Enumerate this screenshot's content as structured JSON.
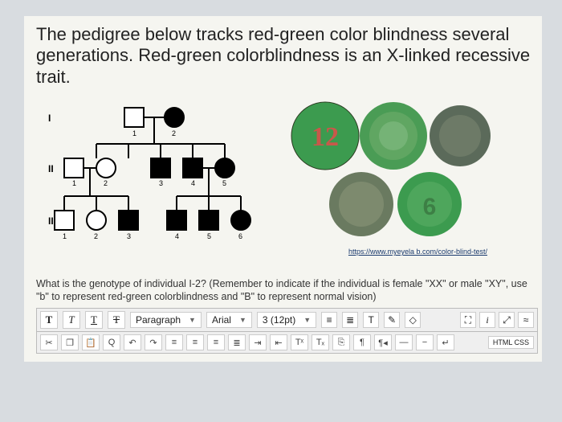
{
  "intro": "The pedigree below tracks red-green color blindness several generations. Red-green colorblindness is an X-linked recessive trait.",
  "pedigree": {
    "generations": [
      "I",
      "II",
      "III"
    ],
    "rows": [
      {
        "label": "I",
        "labels": [
          "1",
          "2"
        ]
      },
      {
        "label": "II",
        "labels": [
          "1",
          "2",
          "3",
          "4",
          "5"
        ]
      },
      {
        "label": "III",
        "labels": [
          "1",
          "2",
          "3",
          "4",
          "5",
          "6"
        ]
      }
    ]
  },
  "plates": {
    "values": [
      "12",
      "",
      "",
      "",
      ""
    ],
    "caption": "https://www.myeyela b.com/color-blind-test/"
  },
  "question": "What is the genotype of individual I-2? (Remember to indicate if the individual is female \"XX\" or male \"XY\", use \"b\" to represent red-green colorblindness and \"B\" to represent normal vision)",
  "toolbar": {
    "bold": "T",
    "italic": "T",
    "underline": "T",
    "strike": "T",
    "paragraph": "Paragraph",
    "font": "Arial",
    "size": "3 (12pt)",
    "html": "HTML CSS"
  }
}
